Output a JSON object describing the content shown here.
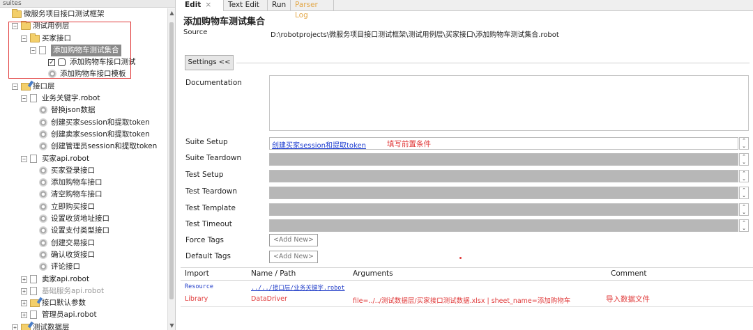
{
  "tree": {
    "header": "suites",
    "rows": [
      {
        "label": "微服务项目接口测试框架",
        "toggle": "",
        "icon": "folder",
        "depth": 0
      },
      {
        "label": "测试用例层",
        "toggle": "−",
        "icon": "folder",
        "depth": 1
      },
      {
        "label": "买家接口",
        "toggle": "−",
        "icon": "folder",
        "depth": 2
      },
      {
        "label": "添加购物车测试集合",
        "toggle": "−",
        "icon": "file",
        "depth": 3,
        "selected": true
      },
      {
        "label": "添加购物车接口测试",
        "toggle": "",
        "icon": "test",
        "depth": 4,
        "checked": true
      },
      {
        "label": "添加购物车接口模板",
        "toggle": "",
        "icon": "gear",
        "depth": 4
      },
      {
        "label": "接口层",
        "toggle": "−",
        "icon": "folder-pen",
        "depth": 1
      },
      {
        "label": "业务关键字.robot",
        "toggle": "−",
        "icon": "file",
        "depth": 2
      },
      {
        "label": "替换json数据",
        "toggle": "",
        "icon": "gear",
        "depth": 3
      },
      {
        "label": "创建买家session和提取token",
        "toggle": "",
        "icon": "gear",
        "depth": 3
      },
      {
        "label": "创建卖家session和提取token",
        "toggle": "",
        "icon": "gear",
        "depth": 3
      },
      {
        "label": "创建管理员session和提取token",
        "toggle": "",
        "icon": "gear",
        "depth": 3
      },
      {
        "label": "买家api.robot",
        "toggle": "−",
        "icon": "file",
        "depth": 2
      },
      {
        "label": "买家登录接口",
        "toggle": "",
        "icon": "gear",
        "depth": 3
      },
      {
        "label": "添加购物车接口",
        "toggle": "",
        "icon": "gear",
        "depth": 3
      },
      {
        "label": "清空购物车接口",
        "toggle": "",
        "icon": "gear",
        "depth": 3
      },
      {
        "label": "立即购买接口",
        "toggle": "",
        "icon": "gear",
        "depth": 3
      },
      {
        "label": "设置收货地址接口",
        "toggle": "",
        "icon": "gear",
        "depth": 3
      },
      {
        "label": "设置支付类型接口",
        "toggle": "",
        "icon": "gear",
        "depth": 3
      },
      {
        "label": "创建交易接口",
        "toggle": "",
        "icon": "gear",
        "depth": 3
      },
      {
        "label": "确认收货接口",
        "toggle": "",
        "icon": "gear",
        "depth": 3
      },
      {
        "label": "评论接口",
        "toggle": "",
        "icon": "gear",
        "depth": 3
      },
      {
        "label": "卖家api.robot",
        "toggle": "+",
        "icon": "file",
        "depth": 2
      },
      {
        "label": "基础服务api.robot",
        "toggle": "+",
        "icon": "file",
        "depth": 2,
        "gray": true
      },
      {
        "label": "接口默认参数",
        "toggle": "+",
        "icon": "folder-pen",
        "depth": 2
      },
      {
        "label": "管理员api.robot",
        "toggle": "+",
        "icon": "file",
        "depth": 2
      },
      {
        "label": "测试数据层",
        "toggle": "+",
        "icon": "folder-pen",
        "depth": 1
      }
    ]
  },
  "tabs": [
    {
      "label": "Edit",
      "close": "×"
    },
    {
      "label": "Text Edit"
    },
    {
      "label": "Run"
    },
    {
      "label": "Parser Log"
    }
  ],
  "suite": {
    "title": "添加购物车测试集合",
    "source_label": "Source",
    "source_path": "D:\\robotprojects\\微服务项目接口测试框架\\测试用例层\\买家接口\\添加购物车测试集合.robot"
  },
  "settings": {
    "button": "Settings <<",
    "documentation_label": "Documentation",
    "suite_setup_label": "Suite Setup",
    "suite_setup_value": "创建买家session和提取token",
    "suite_setup_note": "填写前置条件",
    "suite_teardown_label": "Suite Teardown",
    "test_setup_label": "Test Setup",
    "test_teardown_label": "Test Teardown",
    "test_template_label": "Test Template",
    "test_timeout_label": "Test Timeout",
    "force_tags_label": "Force Tags",
    "default_tags_label": "Default Tags",
    "add_new": "<Add New>"
  },
  "imports": {
    "headers": {
      "import": "Import",
      "name": "Name / Path",
      "args": "Arguments",
      "comment": "Comment"
    },
    "rows": [
      {
        "type": "Resource",
        "path": "../../接口层/业务关键字.robot",
        "args": "",
        "comment": ""
      },
      {
        "type": "Library",
        "path": "DataDriver",
        "args": "file=../../测试数据层/买家接口测试数据.xlsx | sheet_name=添加购物车",
        "comment": "导入数据文件"
      }
    ]
  },
  "colors": {
    "annotation_red": "#e03a3a",
    "link_blue": "#1f3fd0",
    "selected_bg": "#8a8a8a"
  }
}
